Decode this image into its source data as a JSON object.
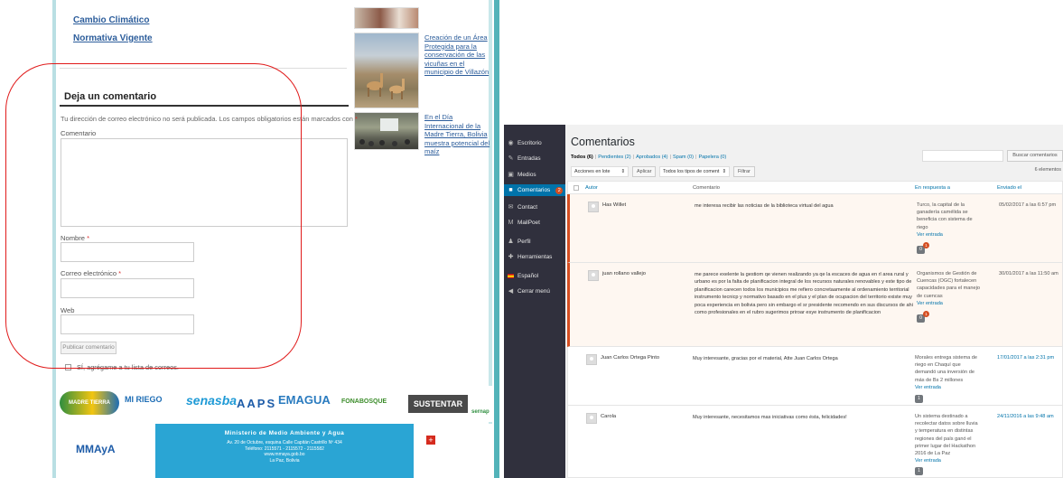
{
  "blog": {
    "links": [
      "Cambio Climático",
      "Normativa Vigente"
    ],
    "sidebar_posts": [
      {
        "title": "Creación de un Área Protegida para la conservación de las vicuñas en el municipio de Villazón"
      },
      {
        "title": "En el Día Internacional de la Madre Tierra, Bolivia muestra potencial del maíz"
      }
    ],
    "form": {
      "title": "Deja un comentario",
      "note": "Tu dirección de correo electrónico no será publicada. Los campos obligatorios están marcados con",
      "required_mark": "*",
      "comment_label": "Comentario",
      "name_label": "Nombre",
      "email_label": "Correo electrónico",
      "web_label": "Web",
      "submit": "Publicar comentario",
      "subscribe": "SÍ, agrégame a tu lista de correos."
    },
    "logos": [
      "MADRE TIERRA",
      "MI RIEGO",
      "senasba",
      "AAPS",
      "EMAGUA",
      "FONABOSQUE",
      "SUSTENTAR",
      "sernap",
      "MMAyA"
    ],
    "footer": {
      "heading": "Ministerio de Medio Ambiente y Agua",
      "line1": "Av. 20 de Octubre, esquina Calle Capitán Castrillo Nº 434",
      "line2": "Teléfono: 2115571 - 2115572 - 2115582",
      "line3": "www.mmaya.gob.bo",
      "line4": "La Paz, Bolivia"
    }
  },
  "wp": {
    "nav": [
      {
        "label": "Escritorio",
        "icon": "dashboard-icon"
      },
      {
        "label": "Entradas",
        "icon": "pin-icon"
      },
      {
        "label": "Medios",
        "icon": "media-icon"
      },
      {
        "label": "Comentarios",
        "icon": "comment-icon",
        "badge": "2",
        "active": true
      },
      {
        "label": "Contact",
        "icon": "mail-icon"
      },
      {
        "label": "MailPoet",
        "icon": "mailpoet-icon"
      },
      {
        "label": "Perfil",
        "icon": "user-icon"
      },
      {
        "label": "Herramientas",
        "icon": "wrench-icon"
      },
      {
        "label": "Español",
        "icon": "flag-icon"
      },
      {
        "label": "Cerrar menú",
        "icon": "collapse-icon"
      }
    ],
    "title": "Comentarios",
    "filters": {
      "all": "Todos",
      "all_count": "(6)",
      "pending": "Pendientes (2)",
      "approved": "Aprobados (4)",
      "spam": "Spam (0)",
      "trash": "Papelera (0)"
    },
    "search_button": "Buscar comentarios",
    "items_count": "6 elementos",
    "bulk_select": "Acciones en lote",
    "apply": "Aplicar",
    "type_select": "Todos los tipos de coment",
    "filter": "Filtrar",
    "columns": {
      "author": "Autor",
      "comment": "Comentario",
      "in_response": "En respuesta a",
      "sent": "Enviado el"
    },
    "rows": [
      {
        "author": "Has Willet",
        "comment": "me interesa recibir las noticias de la biblioteca virtual del agua",
        "response": "Turco, la capital de la ganadería camélida se beneficia con sistema de riego",
        "view": "Ver entrada",
        "bubble": "0",
        "badge": "1",
        "sent": "05/02/2017 a las 6:57 pm",
        "status": "pending"
      },
      {
        "author": "juan rollano vallejo",
        "comment": "me parece exelente la gestiom qe vienen realizando ya qe la escaces de agua en rl area rural y urbano es por la falta de planificacion integral de los recursos naturales renovables y este tipo de planificacion carecen todos los municipios me refiero concretaamente al ordenamiento territorial instrumento tecnicp y normativo basado en el plus y el plan de ocupacion del territorio existe muy poca experiencia en bolivia pero sin embargo el sr presidente recomendo en sus discursos de ahi como profesionales en el rubro sugerimos priroar esye instrumento de planificacion",
        "response": "Organismos de Gestión de Cuencas (OGC) fortalecen capacidades para el manejo de cuencas",
        "view": "Ver entrada",
        "bubble": "0",
        "badge": "1",
        "sent": "30/01/2017 a las 11:50 am",
        "status": "pending"
      },
      {
        "author": "Juan Carlos Ortega Pinto",
        "comment": "Muy interesante, gracias por el material, Atte Juan Carlos Ortega",
        "response": "Morales entrega sistema de riego en Chaquí que demandó una inversión de más de Bs 2 millones",
        "view": "Ver entrada",
        "bubble": "1",
        "sent": "17/01/2017 a las 2:31 pm",
        "status": "approved"
      },
      {
        "author": "Carola",
        "comment": "Muy interesante, necesitamos mas iniciativas como ésta, felicidades!",
        "response": "Un sistema destinado a recolectar datos sobre lluvia y temperatura en distintas regiones del país ganó el primer lugar del Hackathon 2016 de La Paz",
        "view": "Ver entrada",
        "bubble": "1",
        "sent": "24/11/2016 a las 9:48 am",
        "status": "approved"
      }
    ]
  },
  "colors": {
    "annotation_circle": "#e01a1a",
    "wp_sidebar": "#23282d",
    "wp_accent": "#0073aa",
    "pending_border": "#d54e21"
  }
}
